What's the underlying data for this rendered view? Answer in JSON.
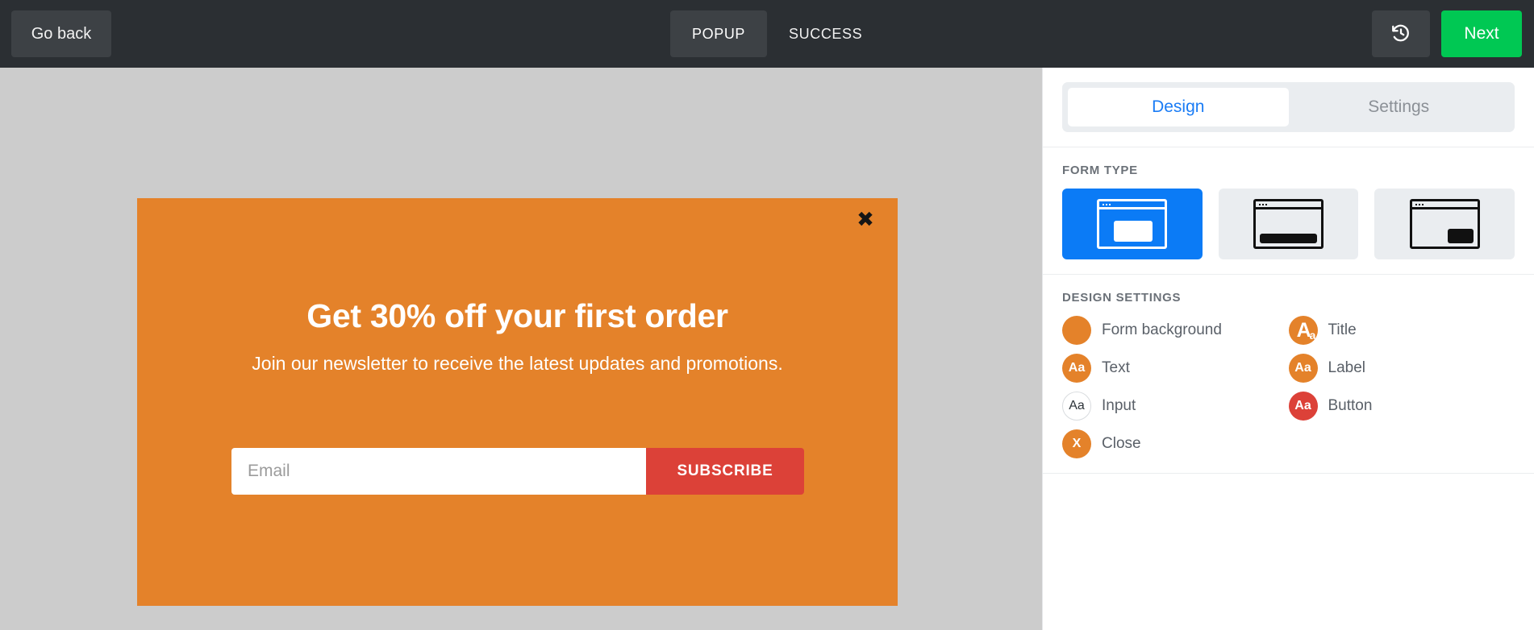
{
  "topbar": {
    "go_back_label": "Go back",
    "steps": [
      {
        "label": "POPUP",
        "active": true
      },
      {
        "label": "SUCCESS",
        "active": false
      }
    ],
    "history_icon": "history-revert-icon",
    "next_label": "Next",
    "next_color": "#00c853",
    "background": "#2b2f33"
  },
  "canvas": {
    "background": "#cccccc",
    "popup": {
      "background": "#e4822a",
      "close_icon": "✖",
      "title": "Get 30% off your first order",
      "description": "Join our newsletter to receive the latest updates and promotions.",
      "input_placeholder": "Email",
      "input_value": "",
      "submit_label": "SUBSCRIBE",
      "submit_color": "#dc4138"
    }
  },
  "panel": {
    "tabs": [
      {
        "label": "Design",
        "active": true
      },
      {
        "label": "Settings",
        "active": false
      }
    ],
    "active_tab_color": "#1a7cf5",
    "form_type": {
      "title": "FORM TYPE",
      "options": [
        {
          "name": "popup-center",
          "selected": true
        },
        {
          "name": "bottom-bar",
          "selected": false
        },
        {
          "name": "corner-box",
          "selected": false
        }
      ],
      "selected_color": "#0b7bf6"
    },
    "design_settings": {
      "title": "DESIGN SETTINGS",
      "items": [
        {
          "label": "Form background",
          "glyph": "",
          "color": "#e4822a",
          "style": "solid"
        },
        {
          "label": "Title",
          "glyph": "Aa",
          "color": "#e4822a",
          "style": "title"
        },
        {
          "label": "Text",
          "glyph": "Aa",
          "color": "#e4822a",
          "style": "solid"
        },
        {
          "label": "Label",
          "glyph": "Aa",
          "color": "#e4822a",
          "style": "solid"
        },
        {
          "label": "Input",
          "glyph": "Aa",
          "color": "#ffffff",
          "style": "outline"
        },
        {
          "label": "Button",
          "glyph": "Aa",
          "color": "#dc4138",
          "style": "solid"
        },
        {
          "label": "Close",
          "glyph": "X",
          "color": "#e4822a",
          "style": "solid"
        }
      ]
    }
  }
}
